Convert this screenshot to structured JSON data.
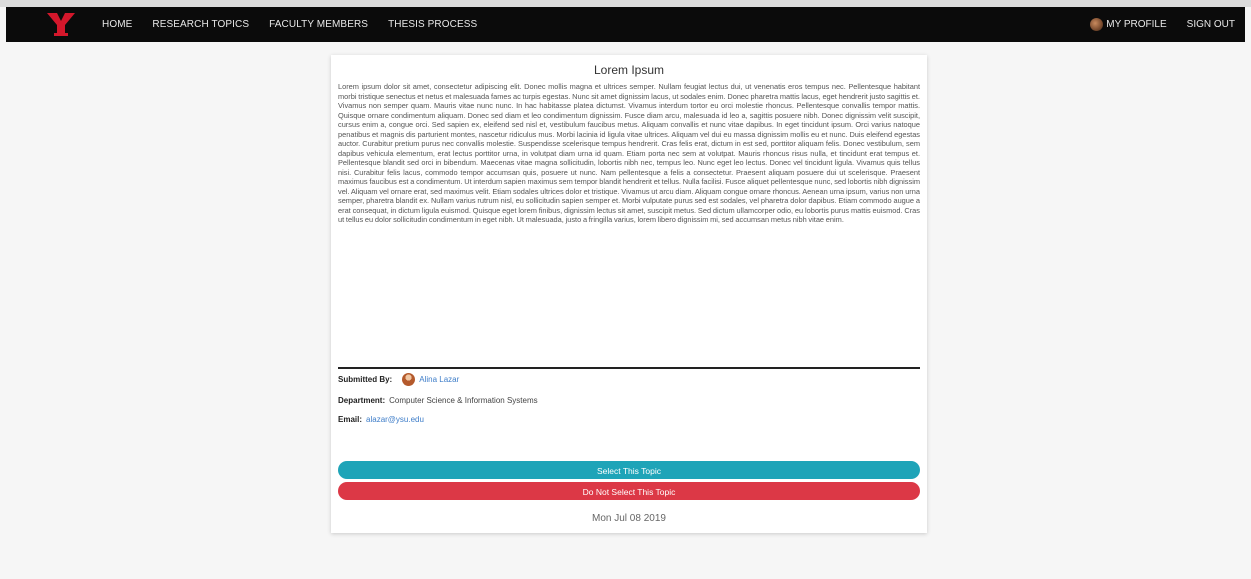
{
  "nav": {
    "links": [
      "HOME",
      "RESEARCH TOPICS",
      "FACULTY MEMBERS",
      "THESIS PROCESS"
    ],
    "profile_label": "MY PROFILE",
    "sign_out_label": "SIGN OUT"
  },
  "topic": {
    "title": "Lorem Ipsum",
    "body": "Lorem ipsum dolor sit amet, consectetur adipiscing elit. Donec mollis magna et ultrices semper. Nullam feugiat lectus dui, ut venenatis eros tempus nec. Pellentesque habitant morbi tristique senectus et netus et malesuada fames ac turpis egestas. Nunc sit amet dignissim lacus, ut sodales enim. Donec pharetra mattis lacus, eget hendrerit justo sagittis et. Vivamus non semper quam. Mauris vitae nunc nunc. In hac habitasse platea dictumst. Vivamus interdum tortor eu orci molestie rhoncus. Pellentesque convallis tempor mattis. Quisque ornare condimentum aliquam. Donec sed diam et leo condimentum dignissim. Fusce diam arcu, malesuada id leo a, sagittis posuere nibh. Donec dignissim velit suscipit, cursus enim a, congue orci. Sed sapien ex, eleifend sed nisl et, vestibulum faucibus metus. Aliquam convallis et nunc vitae dapibus. In eget tincidunt ipsum. Orci varius natoque penatibus et magnis dis parturient montes, nascetur ridiculus mus. Morbi lacinia id ligula vitae ultrices. Aliquam vel dui eu massa dignissim mollis eu et nunc. Duis eleifend egestas auctor. Curabitur pretium purus nec convallis molestie. Suspendisse scelerisque tempus hendrerit. Cras felis erat, dictum in est sed, porttitor aliquam felis. Donec vestibulum, sem dapibus vehicula elementum, erat lectus porttitor urna, in volutpat diam urna id quam. Etiam porta nec sem at volutpat. Mauris rhoncus risus nulla, et tincidunt erat tempus et. Pellentesque blandit sed orci in bibendum. Maecenas vitae magna sollicitudin, lobortis nibh nec, tempus leo. Nunc eget leo lectus. Donec vel tincidunt ligula. Vivamus quis tellus nisi. Curabitur felis lacus, commodo tempor accumsan quis, posuere ut nunc. Nam pellentesque a felis a consectetur. Praesent aliquam posuere dui ut scelerisque. Praesent maximus faucibus est a condimentum. Ut interdum sapien maximus sem tempor blandit hendrerit et tellus. Nulla facilisi. Fusce aliquet pellentesque nunc, sed lobortis nibh dignissim vel. Aliquam vel ornare erat, sed maximus velit. Etiam sodales ultrices dolor et tristique. Vivamus ut arcu diam. Aliquam congue ornare rhoncus. Aenean urna ipsum, varius non urna semper, pharetra blandit ex. Nullam varius rutrum nisl, eu sollicitudin sapien semper et. Morbi vulputate purus sed est sodales, vel pharetra dolor dapibus. Etiam commodo augue a erat consequat, in dictum ligula euismod. Quisque eget lorem finibus, dignissim lectus sit amet, suscipit metus. Sed dictum ullamcorper odio, eu lobortis purus mattis euismod. Cras ut tellus eu dolor sollicitudin condimentum in eget nibh. Ut malesuada, justo a fringilla varius, lorem libero dignissim mi, sed accumsan metus nibh vitae enim.",
    "submitted_by_label": "Submitted By:",
    "submitted_by_name": "Alina Lazar",
    "department_label": "Department:",
    "department": "Computer Science & Information Systems",
    "email_label": "Email:",
    "email": "alazar@ysu.edu",
    "select_label": "Select This Topic",
    "reject_label": "Do Not Select This Topic",
    "date": "Mon Jul 08 2019"
  },
  "colors": {
    "navbar": "#0b0b0b",
    "logo_red": "#d4172b",
    "select_button": "#1ea4b8",
    "reject_button": "#dc3846",
    "link": "#3f7ec9"
  }
}
